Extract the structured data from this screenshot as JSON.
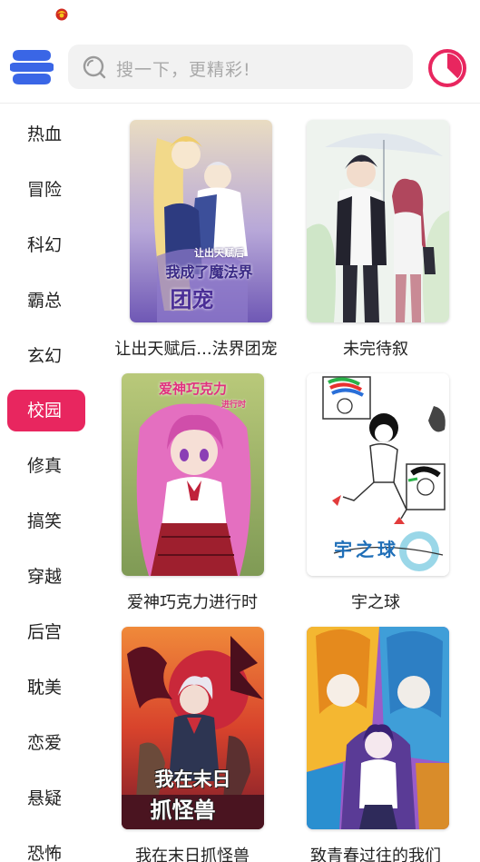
{
  "colors": {
    "accent": "#e8265f",
    "brand_blue": "#3a66e6",
    "search_bg": "#f2f2f2"
  },
  "header": {
    "menu_icon": "menu-icon",
    "search": {
      "placeholder": "搜一下，更精彩!",
      "icon": "search-icon"
    },
    "history_icon": "clock-icon"
  },
  "genres": {
    "selected": "校园",
    "items": [
      "热血",
      "冒险",
      "科幻",
      "霸总",
      "玄幻",
      "校园",
      "修真",
      "搞笑",
      "穿越",
      "后宫",
      "耽美",
      "恋爱",
      "悬疑",
      "恐怖"
    ]
  },
  "comics": [
    {
      "title": "让出天赋后...法界团宠",
      "cover_text": [
        "让出天赋后",
        "我成了魔法界",
        "团宠"
      ]
    },
    {
      "title": "未完待叙"
    },
    {
      "title": "爱神巧克力进行时",
      "cover_text": [
        "爱神巧克力",
        "进行时"
      ]
    },
    {
      "title": "宇之球",
      "cover_text": [
        "宇之球"
      ]
    },
    {
      "title": "我在末日抓怪兽",
      "cover_text": [
        "我在末日",
        "抓怪兽"
      ]
    },
    {
      "title": "致青春过往的我们"
    }
  ]
}
